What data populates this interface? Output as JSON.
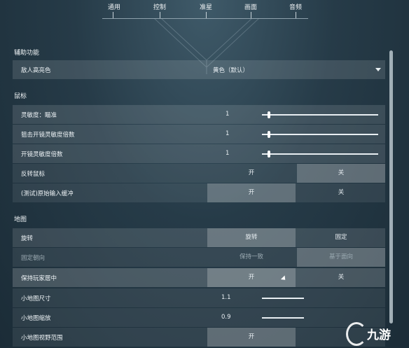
{
  "nav": {
    "tabs": [
      "通用",
      "控制",
      "准星",
      "画面",
      "音频"
    ]
  },
  "sections": {
    "accessibility": "辅助功能",
    "mouse": "鼠标",
    "map": "地图"
  },
  "rows": {
    "enemy_highlight": {
      "label": "敌人高亮色",
      "value": "黄色（默认）"
    },
    "sens_aim": {
      "label": "灵敏度：瞄准",
      "value": "1",
      "level": 0.05
    },
    "sens_sniper": {
      "label": "狙击开镜灵敏度倍数",
      "value": "1",
      "level": 0.05
    },
    "sens_scope": {
      "label": "开镜灵敏度倍数",
      "value": "1",
      "level": 0.05
    },
    "invert_mouse": {
      "label": "反转鼠标",
      "on": "开",
      "off": "关"
    },
    "raw_input": {
      "label": "(测试)原始输入缓冲",
      "on": "开",
      "off": "关"
    },
    "rotate": {
      "label": "旋转",
      "opt_a": "旋转",
      "opt_b": "固定"
    },
    "fixed_dir": {
      "label": "固定朝向",
      "opt_a": "保持一致",
      "opt_b": "基于面向"
    },
    "keep_center": {
      "label": "保持玩家居中",
      "on": "开",
      "off": "关"
    },
    "minimap_size": {
      "label": "小地图尺寸",
      "value": "1.1"
    },
    "minimap_zoom": {
      "label": "小地图缩放",
      "value": "0.9"
    },
    "minimap_view": {
      "label": "小地图视野范围",
      "on": "开"
    }
  },
  "watermark": {
    "text": "九游"
  }
}
